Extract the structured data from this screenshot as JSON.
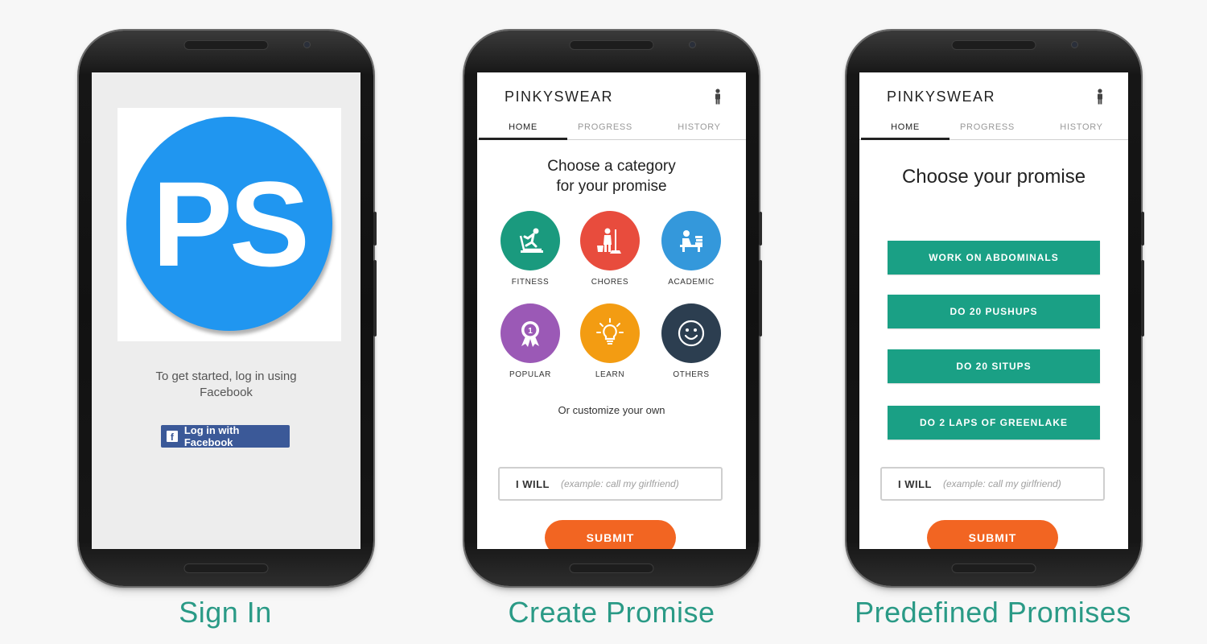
{
  "captions": {
    "signin": "Sign In",
    "create": "Create Promise",
    "predefined": "Predefined Promises"
  },
  "signin": {
    "logo_text": "PS",
    "instructions": "To get started, log in using Facebook",
    "fb_icon": "f",
    "fb_button": "Log in with Facebook"
  },
  "app": {
    "title": "PINKYSWEAR",
    "tabs": [
      "HOME",
      "PROGRESS",
      "HISTORY"
    ],
    "active_tab": "HOME"
  },
  "create": {
    "heading_line1": "Choose a category",
    "heading_line2": "for your promise",
    "categories": [
      {
        "label": "FITNESS",
        "color": "#1a9a7e",
        "icon": "treadmill-icon"
      },
      {
        "label": "CHORES",
        "color": "#e84c3d",
        "icon": "mop-icon"
      },
      {
        "label": "ACADEMIC",
        "color": "#3498db",
        "icon": "desk-study-icon"
      },
      {
        "label": "POPULAR",
        "color": "#9b59b6",
        "icon": "award-ribbon-icon"
      },
      {
        "label": "LEARN",
        "color": "#f39c12",
        "icon": "lightbulb-icon"
      },
      {
        "label": "OTHERS",
        "color": "#2c3e50",
        "icon": "smiley-icon"
      }
    ],
    "customize_text": "Or customize your own"
  },
  "predefined": {
    "heading": "Choose your promise",
    "promises": [
      "WORK ON ABDOMINALS",
      "DO 20 PUSHUPS",
      "DO 20 SITUPS",
      "DO 2 LAPS OF GREENLAKE"
    ]
  },
  "form": {
    "iwill_label": "I WILL",
    "placeholder": "(example: call my girlfriend)",
    "submit": "SUBMIT"
  },
  "colors": {
    "accent_green": "#1aa085",
    "submit_orange": "#f26522",
    "facebook_blue": "#3b5998",
    "logo_blue": "#2096f0",
    "caption_teal": "#2a9a86"
  }
}
